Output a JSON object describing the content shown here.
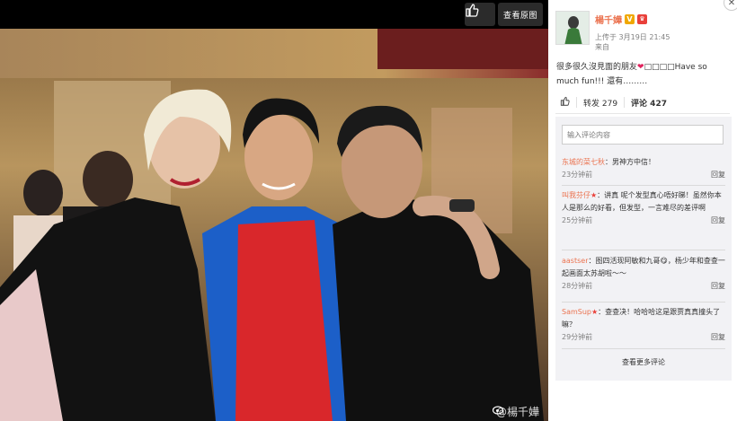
{
  "viewer": {
    "original_label": "查看原图",
    "watermark": "@楊千嬅"
  },
  "post": {
    "author": "楊千嬅",
    "time": "上传于 3月19日 21:45",
    "source": "来自",
    "text_before": "很多很久沒見面的朋友",
    "text_after": "□□□□Have so much fun!!! 還有………",
    "repost_label": "转发 279",
    "comment_label": "评论 427"
  },
  "comment_input": {
    "placeholder": "输入评论内容"
  },
  "comments": [
    {
      "user": "东城的菜七秋",
      "star": false,
      "text": "：男神方中信！",
      "time": "23分钟前",
      "reply": "回复"
    },
    {
      "user": "叫我芬仔",
      "star": true,
      "text": "：讲真 呢个发型真心唔好睇！虽然你本人是那么的好看，但发型，一言难尽的差评啊",
      "time": "25分钟前",
      "reply": "回复"
    },
    {
      "user": "aastser",
      "star": false,
      "text": "：图四活现阿敏和九哥😋，杨少年和查查一起画面太苏胡啦～～",
      "time": "28分钟前",
      "reply": "回复"
    },
    {
      "user": "SamSup",
      "star": true,
      "text": "：查查决！哈哈哈这是跟贾真真撞头了嘛？",
      "time": "29分钟前",
      "reply": "回复"
    }
  ],
  "more_label": "查看更多评论",
  "colors": {
    "accent": "#eb7350",
    "panel_bg": "#f2f2f5"
  },
  "icons": [
    "thumbs-up-icon",
    "close-icon",
    "heart-icon",
    "weibo-icon"
  ]
}
